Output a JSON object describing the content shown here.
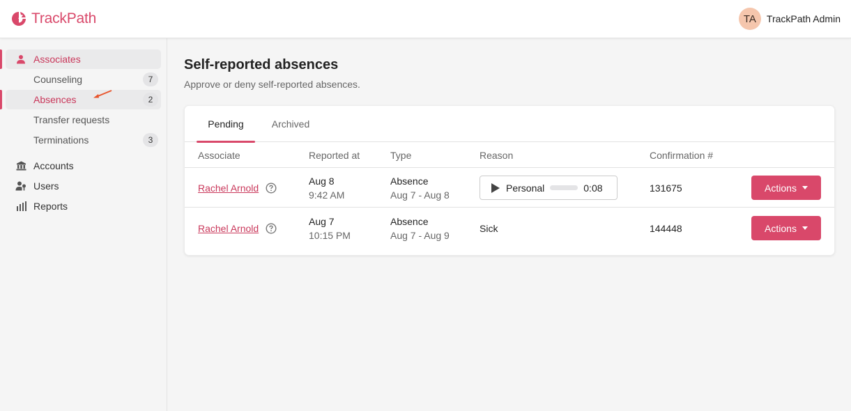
{
  "app": {
    "name": "TrackPath",
    "brand_color": "#d9486a"
  },
  "user": {
    "initials": "TA",
    "name": "TrackPath Admin"
  },
  "sidebar": {
    "items": [
      {
        "label": "Associates",
        "icon": "user-icon",
        "active": true
      },
      {
        "label": "Counseling",
        "badge": "7"
      },
      {
        "label": "Absences",
        "badge": "2",
        "active": true
      },
      {
        "label": "Transfer requests"
      },
      {
        "label": "Terminations",
        "badge": "3"
      },
      {
        "label": "Accounts",
        "icon": "bank-icon"
      },
      {
        "label": "Users",
        "icon": "user-key-icon"
      },
      {
        "label": "Reports",
        "icon": "bar-chart-icon"
      }
    ]
  },
  "main": {
    "title": "Self-reported absences",
    "subtitle": "Approve or deny self-reported absences.",
    "tabs": [
      {
        "label": "Pending",
        "active": true
      },
      {
        "label": "Archived"
      }
    ],
    "table": {
      "columns": [
        "Associate",
        "Reported at",
        "Type",
        "Reason",
        "Confirmation #"
      ],
      "rows": [
        {
          "associate": "Rachel Arnold",
          "reported_date": "Aug 8",
          "reported_time": "9:42 AM",
          "type": "Absence",
          "type_range": "Aug 7 - Aug 8",
          "reason": "Personal",
          "reason_audio_duration": "0:08",
          "reason_audio_progress": 0,
          "confirmation": "131675",
          "action_label": "Actions"
        },
        {
          "associate": "Rachel Arnold",
          "reported_date": "Aug 7",
          "reported_time": "10:15 PM",
          "type": "Absence",
          "type_range": "Aug 7 - Aug 9",
          "reason": "Sick",
          "confirmation": "144448",
          "action_label": "Actions"
        }
      ]
    }
  }
}
